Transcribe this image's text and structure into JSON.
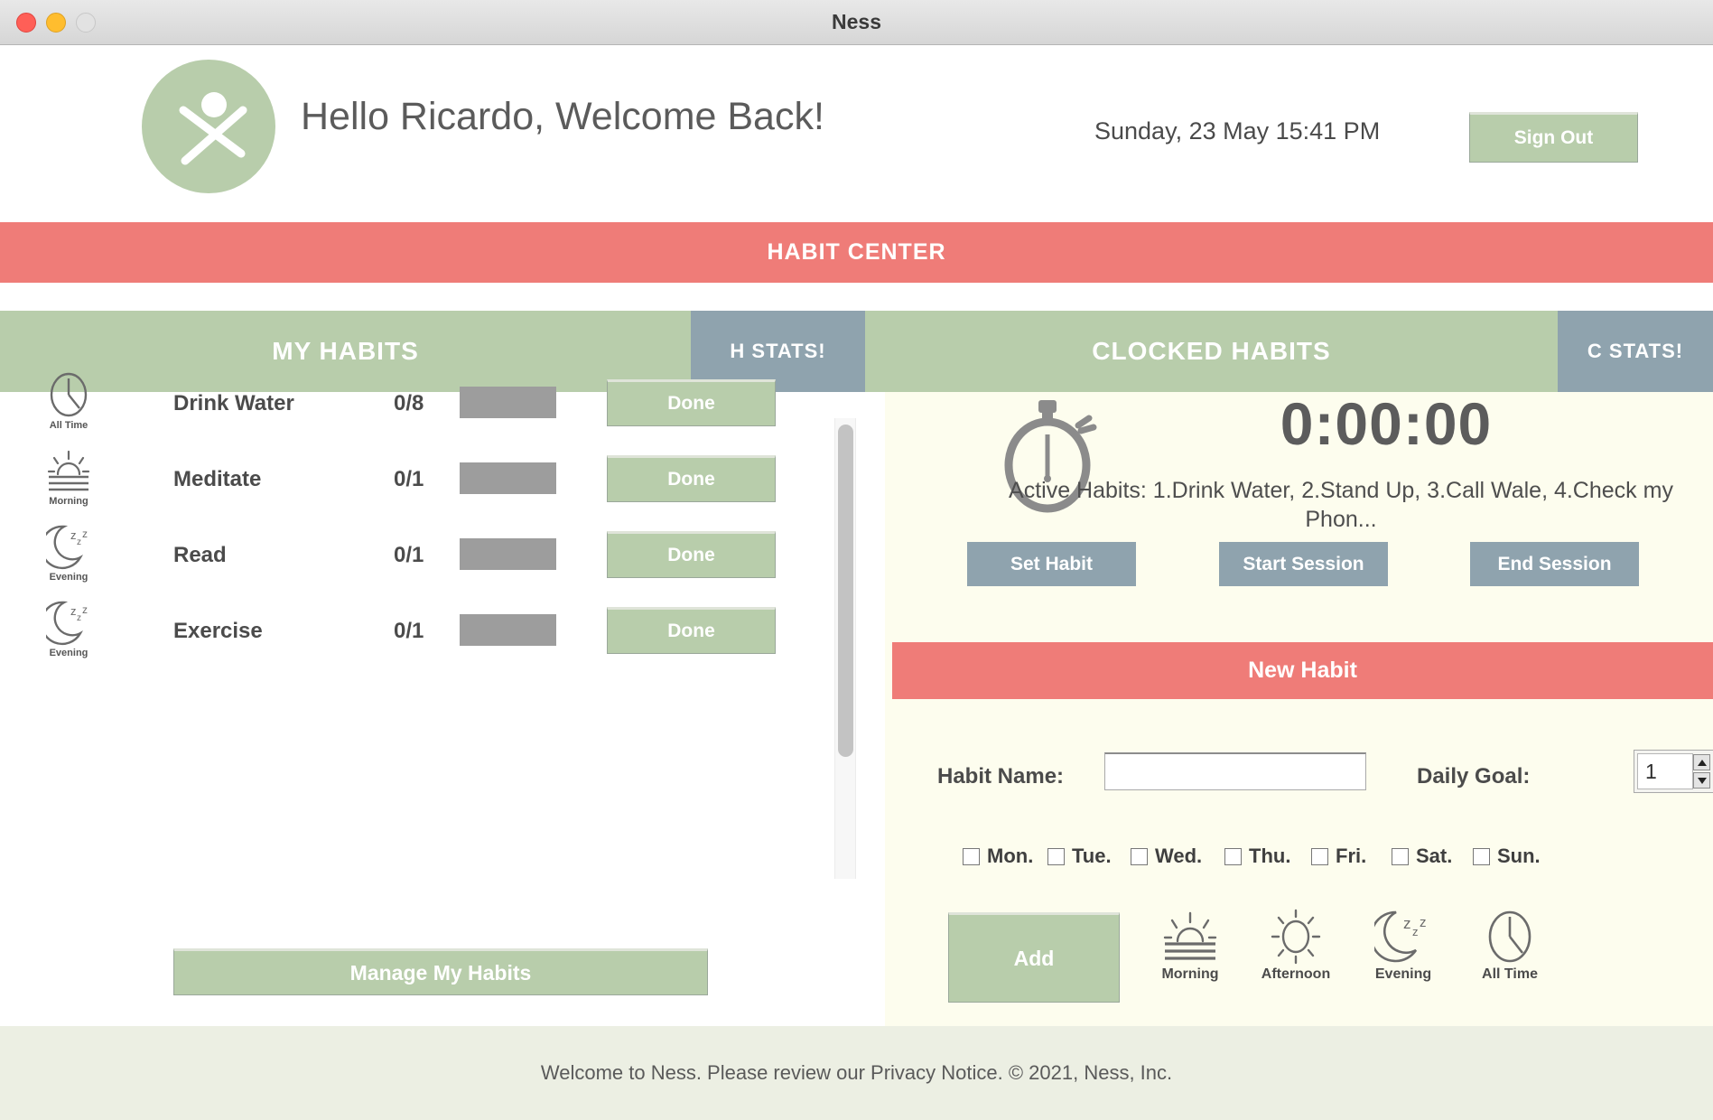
{
  "window": {
    "title": "Ness",
    "traffic_lights": [
      "close",
      "minimize",
      "maximize"
    ]
  },
  "header": {
    "logo_icon": "person-figure-icon",
    "greeting": "Hello Ricardo, Welcome Back!",
    "datetime": "Sunday, 23 May 15:41 PM",
    "sign_out_label": "Sign Out"
  },
  "banner": {
    "label": "HABIT CENTER"
  },
  "tabs": [
    {
      "id": "my-habits",
      "label": "MY HABITS",
      "style": "green"
    },
    {
      "id": "h-stats",
      "label": "H STATS!",
      "style": "blue"
    },
    {
      "id": "clocked-habits",
      "label": "CLOCKED HABITS",
      "style": "green"
    },
    {
      "id": "c-stats",
      "label": "C STATS!",
      "style": "blue"
    }
  ],
  "habits": {
    "done_label": "Done",
    "rows": [
      {
        "icon": "clock-icon",
        "icon_label": "All Time",
        "name": "Drink Water",
        "count": "0/8"
      },
      {
        "icon": "sunrise-icon",
        "icon_label": "Morning",
        "name": "Meditate",
        "count": "0/1"
      },
      {
        "icon": "moon-icon",
        "icon_label": "Evening",
        "name": "Read",
        "count": "0/1"
      },
      {
        "icon": "moon-icon",
        "icon_label": "Evening",
        "name": "Exercise",
        "count": "0/1"
      }
    ],
    "manage_label": "Manage My Habits"
  },
  "clock": {
    "stopwatch_icon": "stopwatch-icon",
    "time": "0:00:00",
    "active_habits": "Active Habits:  1.Drink Water, 2.Stand Up, 3.Call Wale, 4.Check my Phon...",
    "buttons": {
      "set_habit": "Set Habit",
      "start_session": "Start Session",
      "end_session": "End Session"
    }
  },
  "new_habit": {
    "title": "New Habit",
    "habit_name_label": "Habit Name:",
    "habit_name_value": "",
    "habit_name_placeholder": "",
    "daily_goal_label": "Daily Goal:",
    "daily_goal_value": "1",
    "days": [
      {
        "label": "Mon.",
        "checked": false
      },
      {
        "label": "Tue.",
        "checked": false
      },
      {
        "label": "Wed.",
        "checked": false
      },
      {
        "label": "Thu.",
        "checked": false
      },
      {
        "label": "Fri.",
        "checked": false
      },
      {
        "label": "Sat.",
        "checked": false
      },
      {
        "label": "Sun.",
        "checked": false
      }
    ],
    "add_label": "Add",
    "time_of_day": [
      {
        "id": "morning",
        "icon": "sunrise-icon",
        "label": "Morning"
      },
      {
        "id": "afternoon",
        "icon": "sun-icon",
        "label": "Afternoon"
      },
      {
        "id": "evening",
        "icon": "moon-icon",
        "label": "Evening"
      },
      {
        "id": "alltime",
        "icon": "clock-icon",
        "label": "All Time"
      }
    ]
  },
  "footer": {
    "text": "Welcome to Ness. Please review our Privacy Notice. © 2021, Ness, Inc."
  },
  "colors": {
    "green": "#b8cdab",
    "red": "#ef7c78",
    "blue_grey": "#8fa3ae",
    "cream": "#fdfdee",
    "footer_bg": "#ecefe3",
    "bar_grey": "#9d9d9d"
  }
}
